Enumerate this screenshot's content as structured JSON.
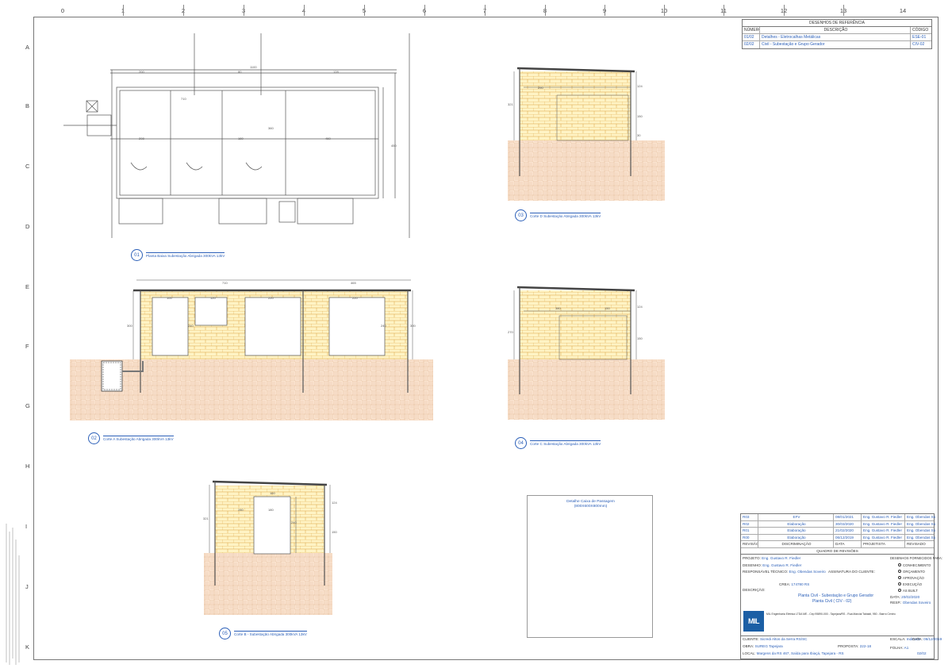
{
  "grid": {
    "columns": [
      "0",
      "1",
      "2",
      "3",
      "4",
      "5",
      "6",
      "7",
      "8",
      "9",
      "10",
      "11",
      "12",
      "13",
      "14"
    ],
    "rows": [
      "A",
      "B",
      "C",
      "D",
      "E",
      "F",
      "G",
      "H",
      "I",
      "J",
      "K"
    ]
  },
  "reference": {
    "title": "DESENHOS DE REFERÊNCIA",
    "headers": [
      "NÚMERO",
      "DESCRIÇÃO",
      "CÓDIGO"
    ],
    "rows": [
      {
        "num": "01/02",
        "desc": "Detalhes - Eletrocalhas Metálicas",
        "code": "ESE-01"
      },
      {
        "num": "02/02",
        "desc": "Civil - Subestação e Grupo Gerador",
        "code": "CIV-02"
      }
    ]
  },
  "captions": {
    "c1": {
      "num": "01",
      "text": "Planta Baixa Subestação Abrigada 300kVA 13kV"
    },
    "c2": {
      "num": "02",
      "text": "Corte A Subestação Abrigada 300kVA 13kV"
    },
    "c3": {
      "num": "03",
      "text": "Corte D Subestação Abrigada 300kVA 13kV"
    },
    "c4": {
      "num": "04",
      "text": "Corte C Subestação Abrigada 300kVA 13kV"
    },
    "c5": {
      "num": "05",
      "text": "Corte B - Subestação Abrigada 300kVA 13kV"
    }
  },
  "detail": {
    "title": "Detalhe Caixa de Passagem",
    "subtitle": "(800X600X800mm)"
  },
  "revisions": {
    "headers": [
      "REVISÃO",
      "DISCRIMINAÇÃO",
      "DATA",
      "PROJETISTA",
      "REVISADO"
    ],
    "rows": [
      {
        "rev": "R03",
        "desc": "EFV",
        "date": "08/01/2021",
        "designer": "Eng. Gustavo R. Fiedler",
        "reviewer": "Eng. Obendas Soveiro"
      },
      {
        "rev": "R02",
        "desc": "Elaboração",
        "date": "30/03/2020",
        "designer": "Eng. Gustavo R. Fiedler",
        "reviewer": "Eng. Obendas Soveiro"
      },
      {
        "rev": "R01",
        "desc": "Elaboração",
        "date": "21/02/2020",
        "designer": "Eng. Gustavo R. Fiedler",
        "reviewer": "Eng. Obendas Soveiro"
      },
      {
        "rev": "R00",
        "desc": "Elaboração",
        "date": "06/12/2019",
        "designer": "Eng. Gustavo R. Fiedler",
        "reviewer": "Eng. Obendas Soveiro"
      }
    ],
    "table_title": "QUADRO DE REVISÕES"
  },
  "titleblock": {
    "projeto_label": "PROJETO:",
    "projeto": "Eng. Gustavo R. Fiedler",
    "desenho_label": "DESENHO:",
    "desenho": "Eng. Gustavo R. Fiedler",
    "resp_label": "RESPONSÁVEL TÉCNICO:",
    "resp": "Eng. Obendas Soveiro",
    "assinatura_label": "ASSINATURA DO CLIENTE:",
    "crea_label": "CREA:",
    "crea": "174780 RS",
    "descricao_label": "DESCRIÇÃO:",
    "descricao1": "Planta Civil - Subestação e Grupo Gerador",
    "descricao2": "Planta Civil ( CIV - 02)",
    "formas_title": "DESENHOS FORNECIDOS PARA:",
    "formas": [
      "CONHECIMENTO",
      "ORÇAMENTO",
      "APROVAÇÃO",
      "EXECUÇÃO",
      "AS BUILT"
    ],
    "data_label": "DATA:",
    "data": "20/02/2020",
    "resp2_label": "RESP.:",
    "resp2": "Obendas Soveiro",
    "company_text": "MIL Engenharia Elétrica LTDA ME - Cep 95890-000 - Tapejara/RS - Rua Marcial Tabaldi, 950 - Bairro Centro",
    "company_logo": "MIL",
    "cliente_label": "CLIENTE:",
    "cliente": "Sicredi Altos da Serra RS/SC",
    "escala_label": "ESCALA:",
    "escala": "Indicada",
    "datafim_label": "DATA:",
    "datafim": "06/12/2019",
    "obra_label": "OBRA:",
    "obra": "SUREG Tapejara",
    "proposta_label": "PROPOSTA:",
    "proposta": "222-18",
    "folha_label": "FOLHA:",
    "folha": "A1",
    "local_label": "LOCAL:",
    "local": "Margens da RS 467, Saída para Ibiaçá, Tapejara - RS",
    "numero": "02/02"
  },
  "colors": {
    "brick": "#fff3c4",
    "brick_line": "#d9a441",
    "ground": "#fae3cf",
    "ground_line": "#e0b895",
    "blue": "#2b5fb8",
    "logo": "#1c5fa5"
  }
}
